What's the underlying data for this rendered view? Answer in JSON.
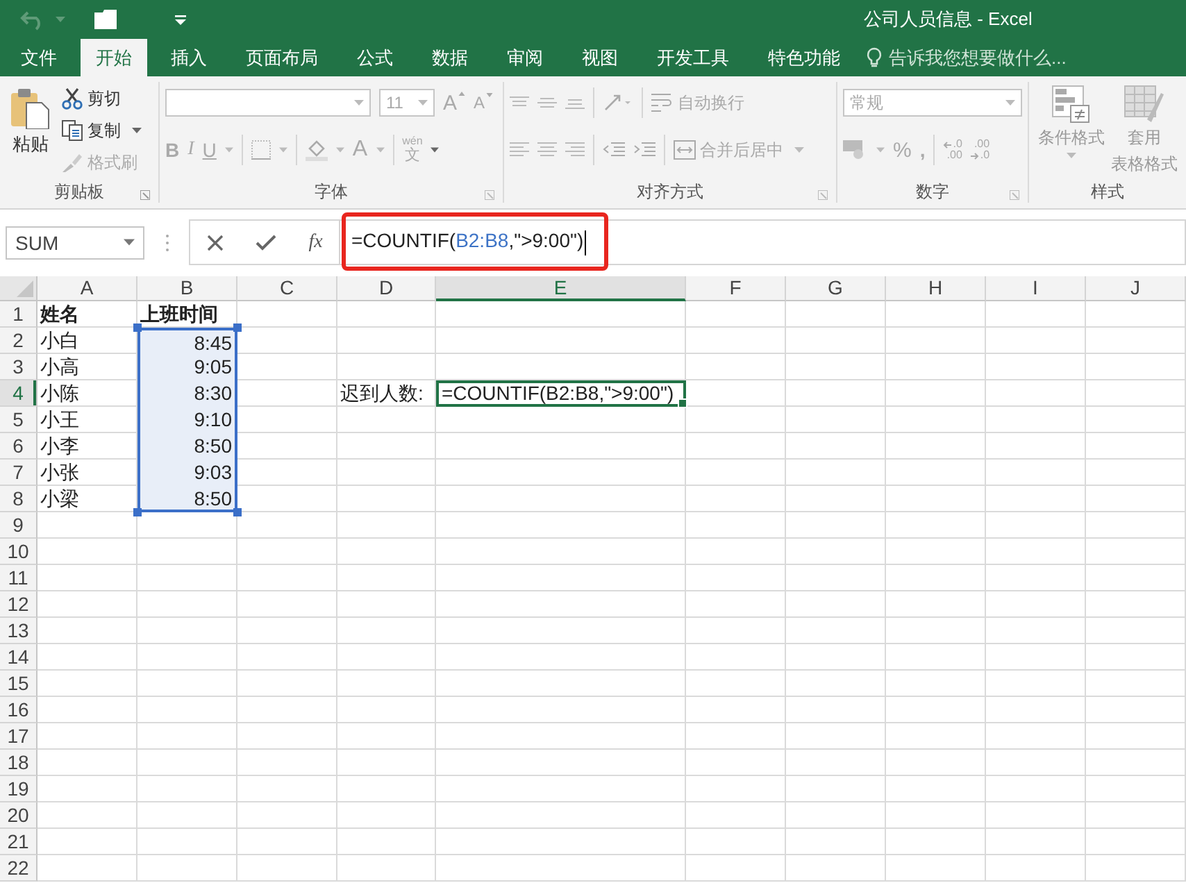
{
  "window": {
    "title": "公司人员信息 - Excel"
  },
  "tabs": [
    {
      "label": "文件",
      "selected": false
    },
    {
      "label": "开始",
      "selected": true
    },
    {
      "label": "插入",
      "selected": false
    },
    {
      "label": "页面布局",
      "selected": false
    },
    {
      "label": "公式",
      "selected": false
    },
    {
      "label": "数据",
      "selected": false
    },
    {
      "label": "审阅",
      "selected": false
    },
    {
      "label": "视图",
      "selected": false
    },
    {
      "label": "开发工具",
      "selected": false
    },
    {
      "label": "特色功能",
      "selected": false
    }
  ],
  "tell_me": {
    "placeholder": "告诉我您想要做什么..."
  },
  "ribbon": {
    "disabled": true,
    "clipboard": {
      "label": "剪贴板",
      "paste": "粘贴",
      "cut": "剪切",
      "copy": "复制",
      "format_painter": "格式刷"
    },
    "font": {
      "label": "字体",
      "size": "11",
      "grow": "A",
      "shrink": "A",
      "bold": "B",
      "italic": "I",
      "underline": "U",
      "font_color": "A",
      "phonetic_top": "wén",
      "phonetic_bottom": "文"
    },
    "alignment": {
      "label": "对齐方式",
      "wrap_text": "自动换行",
      "merge_center": "合并后居中"
    },
    "number": {
      "label": "数字",
      "format": "常规",
      "percent": "%",
      "comma": ",",
      "increase_top": ".0",
      "increase_bottom": ".00",
      "decrease_top": ".00",
      "decrease_bottom": ".0"
    },
    "styles": {
      "label": "样式",
      "conditional": "条件格式",
      "table_top": "套用",
      "table_bottom": "表格格式"
    }
  },
  "formula_bar": {
    "name_box": "SUM",
    "fx": "fx",
    "highlighted": true,
    "parts": [
      {
        "kind": "text",
        "text": "=COUNTIF("
      },
      {
        "kind": "ref",
        "text": "B2:B8"
      },
      {
        "kind": "text",
        "text": ",\">9:00\")"
      }
    ]
  },
  "columns": [
    {
      "label": "A",
      "selected": false
    },
    {
      "label": "B",
      "selected": false
    },
    {
      "label": "C",
      "selected": false
    },
    {
      "label": "D",
      "selected": false
    },
    {
      "label": "E",
      "selected": true
    },
    {
      "label": "F",
      "selected": false
    },
    {
      "label": "G",
      "selected": false
    },
    {
      "label": "H",
      "selected": false
    },
    {
      "label": "I",
      "selected": false
    },
    {
      "label": "J",
      "selected": false
    }
  ],
  "rows": [
    {
      "number": "1",
      "selected": false,
      "cells": {
        "A": {
          "text": "姓名",
          "kind": "heading",
          "selected": false
        },
        "B": {
          "text": "上班时间",
          "kind": "heading",
          "selected": false
        }
      }
    },
    {
      "number": "2",
      "selected": false,
      "cells": {
        "A": {
          "text": "小白",
          "kind": "text",
          "selected": false
        },
        "B": {
          "text": "8:45",
          "kind": "time",
          "selected": true
        }
      }
    },
    {
      "number": "3",
      "selected": false,
      "cells": {
        "A": {
          "text": "小高",
          "kind": "text",
          "selected": false
        },
        "B": {
          "text": "9:05",
          "kind": "time",
          "selected": true
        }
      }
    },
    {
      "number": "4",
      "selected": true,
      "cells": {
        "A": {
          "text": "小陈",
          "kind": "text",
          "selected": false
        },
        "B": {
          "text": "8:30",
          "kind": "time",
          "selected": true
        },
        "D": {
          "text": "迟到人数:",
          "kind": "text",
          "selected": false
        },
        "E": {
          "text": "=COUNTIF(B2:B8,\">9:00\")",
          "kind": "editing",
          "selected": false
        }
      }
    },
    {
      "number": "5",
      "selected": false,
      "cells": {
        "A": {
          "text": "小王",
          "kind": "text",
          "selected": false
        },
        "B": {
          "text": "9:10",
          "kind": "time",
          "selected": true
        }
      }
    },
    {
      "number": "6",
      "selected": false,
      "cells": {
        "A": {
          "text": "小李",
          "kind": "text",
          "selected": false
        },
        "B": {
          "text": "8:50",
          "kind": "time",
          "selected": true
        }
      }
    },
    {
      "number": "7",
      "selected": false,
      "cells": {
        "A": {
          "text": "小张",
          "kind": "text",
          "selected": false
        },
        "B": {
          "text": "9:03",
          "kind": "time",
          "selected": true
        }
      }
    },
    {
      "number": "8",
      "selected": false,
      "cells": {
        "A": {
          "text": "小梁",
          "kind": "text",
          "selected": false
        },
        "B": {
          "text": "8:50",
          "kind": "time",
          "selected": true
        }
      }
    },
    {
      "number": "9",
      "selected": false
    },
    {
      "number": "10",
      "selected": false
    },
    {
      "number": "11",
      "selected": false
    },
    {
      "number": "12",
      "selected": false
    },
    {
      "number": "13",
      "selected": false
    },
    {
      "number": "14",
      "selected": false
    },
    {
      "number": "15",
      "selected": false
    },
    {
      "number": "16",
      "selected": false
    },
    {
      "number": "17",
      "selected": false
    },
    {
      "number": "18",
      "selected": false
    },
    {
      "number": "19",
      "selected": false
    },
    {
      "number": "20",
      "selected": false
    },
    {
      "number": "21",
      "selected": false
    },
    {
      "number": "22",
      "selected": false
    }
  ]
}
